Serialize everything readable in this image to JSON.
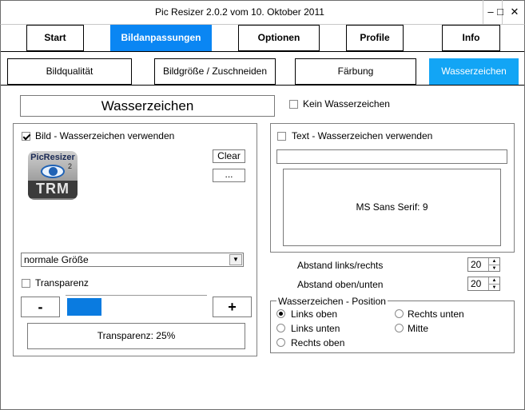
{
  "window": {
    "title": "Pic Resizer 2.0.2 vom 10. Oktober 2011",
    "minimize": "–",
    "maximize": "□",
    "close": "✕"
  },
  "main_tabs": [
    {
      "label": "Start"
    },
    {
      "label": "Bildanpassungen"
    },
    {
      "label": "Optionen"
    },
    {
      "label": "Profile"
    },
    {
      "label": "Info"
    }
  ],
  "sub_tabs": [
    {
      "label": "Bildqualität"
    },
    {
      "label": "Bildgröße / Zuschneiden"
    },
    {
      "label": "Färbung"
    },
    {
      "label": "Wasserzeichen"
    }
  ],
  "section_title": "Wasserzeichen",
  "no_watermark": {
    "label": "Kein Wasserzeichen",
    "checked": false
  },
  "image_wm": {
    "label": "Bild - Wasserzeichen verwenden",
    "checked": true,
    "logo_top": "PicResizer",
    "logo_sup": "2",
    "logo_bottom": "TRM",
    "clear_label": "Clear",
    "browse_label": "...",
    "size_selected": "normale Größe",
    "transparency_label": "Transparenz",
    "transparency_checked": false,
    "minus_label": "-",
    "plus_label": "+",
    "transparency_value": 0.25,
    "transparency_text": "Transparenz: 25%"
  },
  "text_wm": {
    "label": "Text - Wasserzeichen verwenden",
    "checked": false,
    "text_value": "",
    "font_preview": "MS Sans Serif: 9"
  },
  "spacing": {
    "horizontal_label": "Abstand links/rechts",
    "horizontal_value": "20",
    "vertical_label": "Abstand oben/unten",
    "vertical_value": "20"
  },
  "position": {
    "legend": "Wasserzeichen - Position",
    "options": [
      {
        "label": "Links oben",
        "selected": true
      },
      {
        "label": "Links unten",
        "selected": false
      },
      {
        "label": "Rechts oben",
        "selected": false
      },
      {
        "label": "Rechts unten",
        "selected": false
      },
      {
        "label": "Mitte",
        "selected": false
      }
    ]
  },
  "colors": {
    "main_tab_active": "#0a86f3",
    "sub_tab_active": "#12a5f5",
    "slider_fill": "#0a7be0"
  }
}
